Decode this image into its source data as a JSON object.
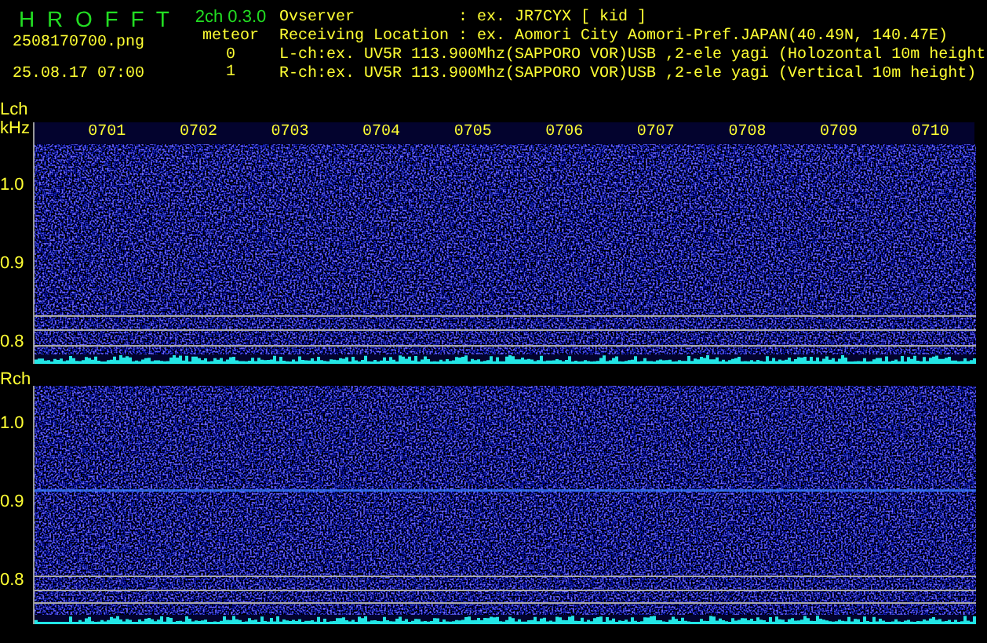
{
  "header": {
    "title": "H R O F F T",
    "filename": "2508170700.png",
    "timestamp": "25.08.17 07:00",
    "version": "2ch 0.3.0",
    "count_label": "meteor",
    "counts": [
      "0",
      "1"
    ],
    "info": [
      {
        "label": "Ovserver",
        "value": ": ex. JR7CYX [ kid ]"
      },
      {
        "label": "Receiving Location",
        "value": ": ex. Aomori City Aomori-Pref.JAPAN(40.49N, 140.47E)"
      }
    ],
    "channel_info": [
      "L-ch:ex. UV5R 113.900Mhz(SAPPORO VOR)USB ,2-ele yagi (Holozontal 10m height",
      "R-ch:ex. UV5R 113.900Mhz(SAPPORO VOR)USB ,2-ele yagi (Vertical 10m height)"
    ]
  },
  "channels": [
    {
      "label": "Lch",
      "unit": "kHz",
      "time_labels": [
        "0701",
        "0702",
        "0703",
        "0704",
        "0705",
        "0706",
        "0707",
        "0708",
        "0709",
        "0710"
      ],
      "ticks": [
        "1.0",
        "0.9",
        "0.8"
      ],
      "meteor_trace": false
    },
    {
      "label": "Rch",
      "ticks": [
        "1.0",
        "0.9",
        "0.8"
      ],
      "meteor_trace": true
    }
  ]
}
